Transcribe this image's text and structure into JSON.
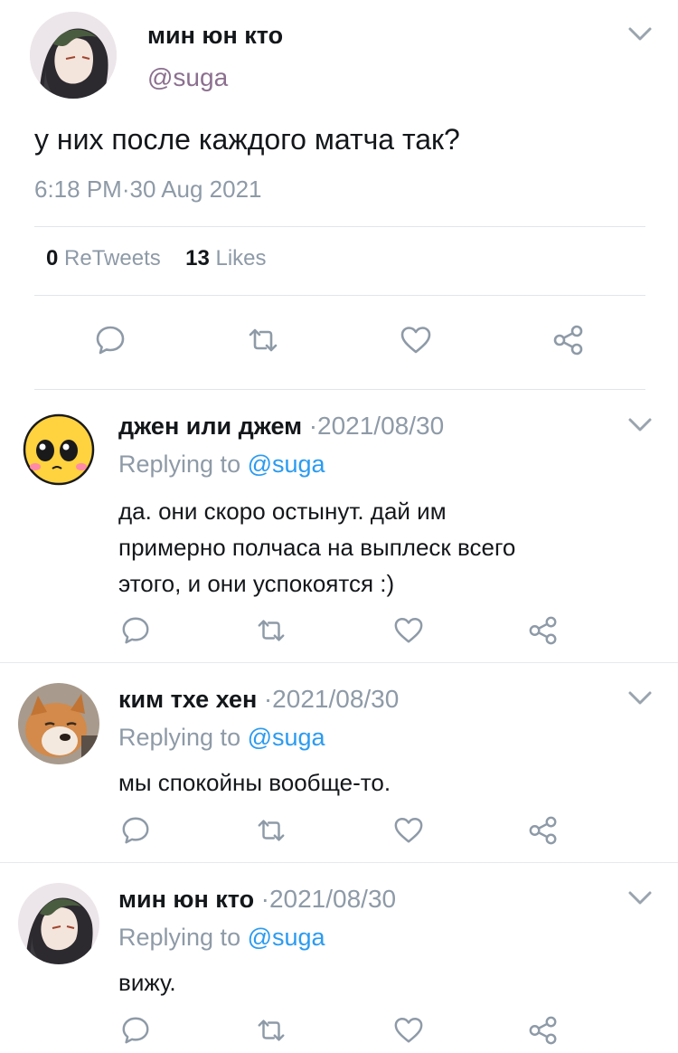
{
  "main_tweet": {
    "display_name": "мин юн кто",
    "handle": "@suga",
    "text": "у них после каждого матча так?",
    "timestamp": "6:18 PM·30 Aug 2021",
    "retweets_count": "0",
    "retweets_label": "ReTweets",
    "likes_count": "13",
    "likes_label": "Likes"
  },
  "replies": [
    {
      "display_name": "джен или джем",
      "date": "·2021/08/30",
      "replying_prefix": "Replying to ",
      "replying_handle": "@suga",
      "text_lines": [
        "да. они скоро остынут. дай им",
        "примерно полчаса на выплеск всего",
        "этого, и они успокоятся :)"
      ],
      "avatar": "emoji-face-avatar"
    },
    {
      "display_name": "ким тхе хен",
      "date": "·2021/08/30",
      "replying_prefix": "Replying to ",
      "replying_handle": "@suga",
      "text_lines": [
        "мы спокойны вообще-то."
      ],
      "avatar": "dog-avatar"
    },
    {
      "display_name": "мин юн кто",
      "date": "·2021/08/30",
      "replying_prefix": "Replying to ",
      "replying_handle": "@suga",
      "text_lines": [
        "вижу."
      ],
      "avatar": "anime-character-avatar"
    }
  ],
  "icons": {
    "reply": "speech-bubble-icon",
    "retweet": "retweet-icon",
    "like": "heart-icon",
    "share": "share-icon",
    "more": "chevron-down-icon"
  },
  "colors": {
    "text": "#14171a",
    "muted": "#8e9aa7",
    "handle": "#8c6f8f",
    "mention": "#2b9bf0",
    "divider": "#e1e5e9"
  }
}
